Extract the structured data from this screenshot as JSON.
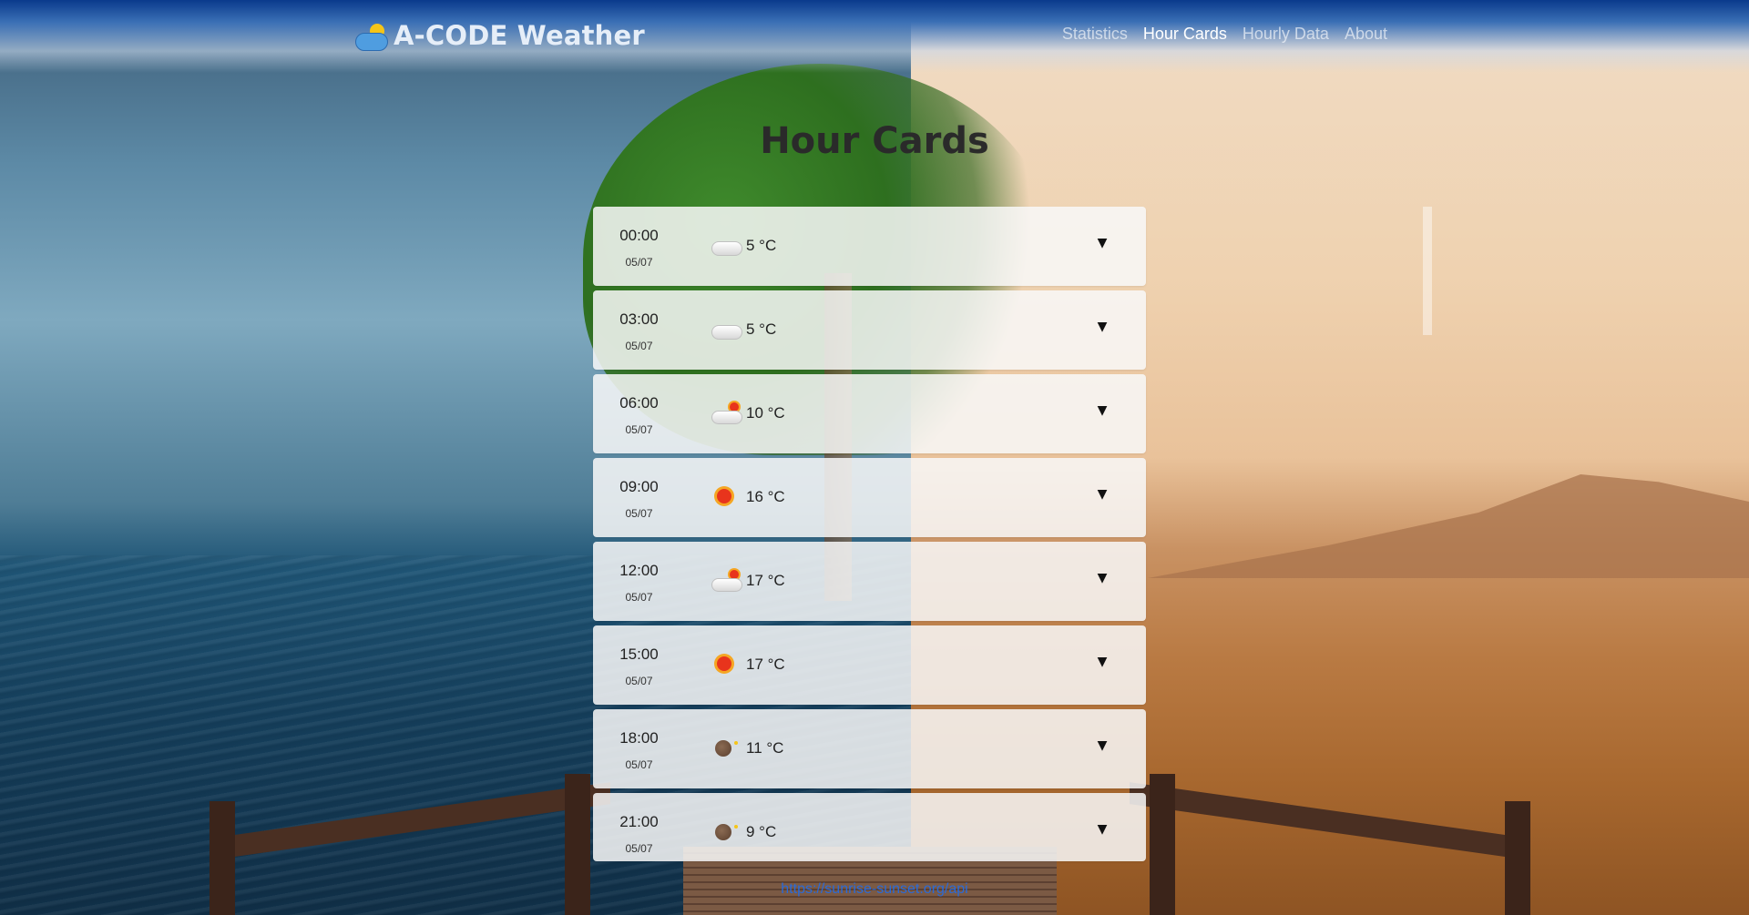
{
  "header": {
    "brand": "A-CODE Weather",
    "brand_icon": "sun-cloud-icon",
    "nav": [
      {
        "label": "Statistics",
        "active": false
      },
      {
        "label": "Hour Cards",
        "active": true
      },
      {
        "label": "Hourly Data",
        "active": false
      },
      {
        "label": "About",
        "active": false
      }
    ]
  },
  "main": {
    "title": "Hour Cards",
    "cards": [
      {
        "time": "00:00",
        "date": "05/07",
        "icon": "cloud-icon",
        "temp": "5 °C"
      },
      {
        "time": "03:00",
        "date": "05/07",
        "icon": "cloud-icon",
        "temp": "5 °C"
      },
      {
        "time": "06:00",
        "date": "05/07",
        "icon": "partly-cloudy-icon",
        "temp": "10 °C"
      },
      {
        "time": "09:00",
        "date": "05/07",
        "icon": "sun-icon",
        "temp": "16 °C"
      },
      {
        "time": "12:00",
        "date": "05/07",
        "icon": "partly-cloudy-icon",
        "temp": "17 °C"
      },
      {
        "time": "15:00",
        "date": "05/07",
        "icon": "sun-icon",
        "temp": "17 °C"
      },
      {
        "time": "18:00",
        "date": "05/07",
        "icon": "moon-icon",
        "temp": "11 °C"
      },
      {
        "time": "21:00",
        "date": "05/07",
        "icon": "moon-icon",
        "temp": "9 °C"
      }
    ],
    "toggle_glyph": "▼"
  },
  "footer": {
    "link": "https://sunrise-sunset.org/api"
  },
  "colors": {
    "header_top": "#0a3a8c",
    "nav_active": "#ffffff",
    "link": "#2a6ad8"
  }
}
